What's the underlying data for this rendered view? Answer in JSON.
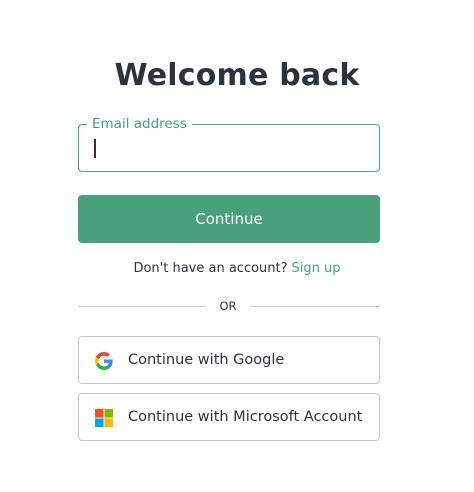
{
  "page": {
    "title": "Welcome back"
  },
  "login_form": {
    "email": {
      "label": "Email address",
      "value": "",
      "placeholder": ""
    },
    "continue_label": "Continue",
    "signup_prompt": "Don't have an account?",
    "signup_link": "Sign up",
    "divider_text": "OR"
  },
  "social_logins": {
    "google": {
      "label": "Continue with Google",
      "icon": "google-logo-icon"
    },
    "microsoft": {
      "label": "Continue with Microsoft Account",
      "icon": "microsoft-logo-icon"
    }
  },
  "colors": {
    "accent": "#4a9f7d",
    "text": "#2d333a",
    "border": "#c2c8d0",
    "background": "#ffffff"
  }
}
